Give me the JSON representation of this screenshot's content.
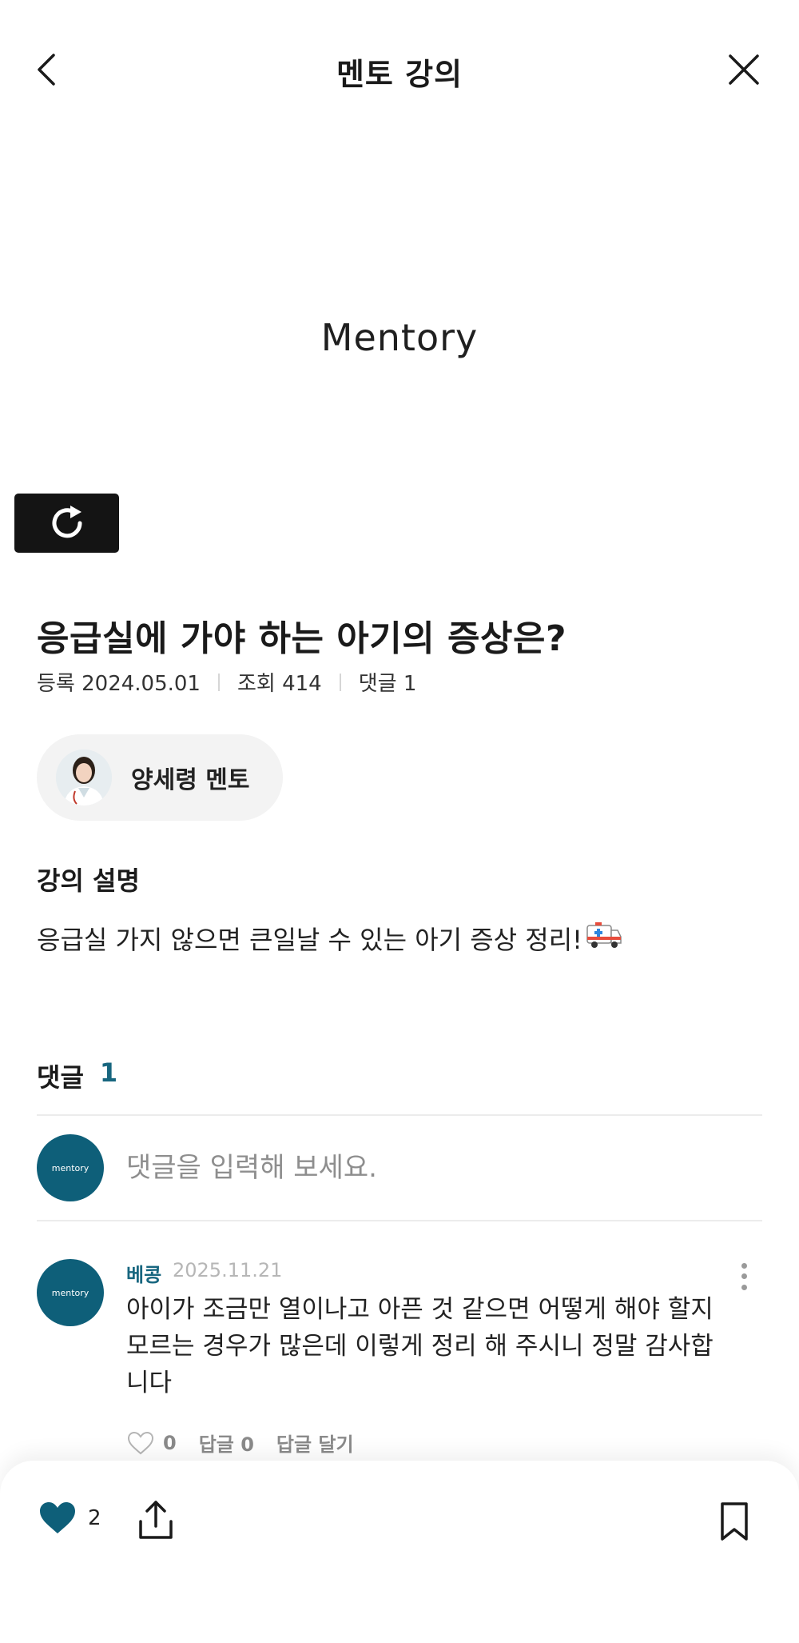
{
  "header": {
    "title": "멘토 강의",
    "back_icon": "chevron-left-icon",
    "close_icon": "close-icon"
  },
  "video": {
    "logo_text": "Mentory",
    "replay_icon": "replay-icon"
  },
  "lecture": {
    "title": "응급실에 가야 하는 아기의 증상은?",
    "meta": {
      "registered": "등록 2024.05.01",
      "views": "조회 414",
      "comments": "댓글 1"
    }
  },
  "mentor": {
    "name": "양세령 멘토"
  },
  "description": {
    "label": "강의 설명",
    "text": "응급실 가지 않으면 큰일날 수 있는 아기 증상 정리!",
    "emoji": "🚑"
  },
  "comments": {
    "label": "댓글",
    "count": "1",
    "input_placeholder": "댓글을 입력해 보세요.",
    "avatar_text": "mentory",
    "items": [
      {
        "author": "베콩",
        "date": "2025.11.21",
        "body": "아이가 조금만 열이나고 아픈 것 같으면 어떻게 해야 할지 모르는 경우가 많은데 이렇게 정리 해 주시니 정말 감사합니다",
        "likes": "0",
        "replies": "답글 0",
        "reply_action": "답글 달기"
      }
    ]
  },
  "bottom_bar": {
    "like_count": "2",
    "colors": {
      "accent": "#0e5f79",
      "text": "#222222"
    }
  }
}
